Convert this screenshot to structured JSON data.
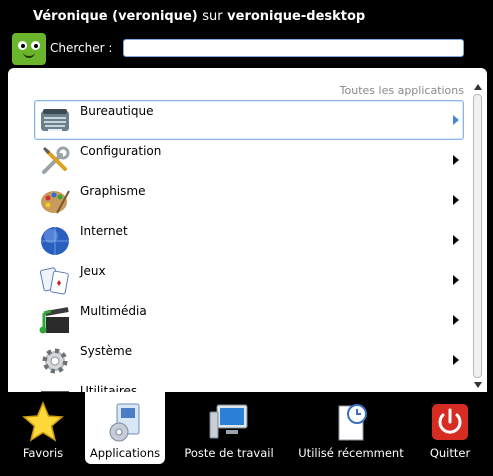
{
  "header": {
    "user": "Véronique (veronique)",
    "sur": "sur",
    "host": "veronique-desktop"
  },
  "search": {
    "label": "Chercher :",
    "value": "",
    "placeholder": ""
  },
  "panel": {
    "heading": "Toutes les applications",
    "categories": [
      {
        "label": "Bureautique",
        "icon": "typewriter-icon",
        "selected": true
      },
      {
        "label": "Configuration",
        "icon": "tools-icon",
        "selected": false
      },
      {
        "label": "Graphisme",
        "icon": "palette-icon",
        "selected": false
      },
      {
        "label": "Internet",
        "icon": "globe-icon",
        "selected": false
      },
      {
        "label": "Jeux",
        "icon": "cards-icon",
        "selected": false
      },
      {
        "label": "Multimédia",
        "icon": "clapboard-music-icon",
        "selected": false
      },
      {
        "label": "Système",
        "icon": "gear-icon",
        "selected": false
      },
      {
        "label": "Utilitaires",
        "icon": "utilities-icon",
        "selected": false
      }
    ]
  },
  "tabs": [
    {
      "label": "Favoris",
      "icon": "star-icon",
      "active": false
    },
    {
      "label": "Applications",
      "icon": "applications-icon",
      "active": true
    },
    {
      "label": "Poste de travail",
      "icon": "computer-icon",
      "active": false
    },
    {
      "label": "Utilisé récemment",
      "icon": "recent-documents-icon",
      "active": false
    },
    {
      "label": "Quitter",
      "icon": "power-icon",
      "active": false
    }
  ],
  "colors": {
    "accent": "#8ab4e8",
    "background": "#000000",
    "panel": "#ffffff"
  }
}
